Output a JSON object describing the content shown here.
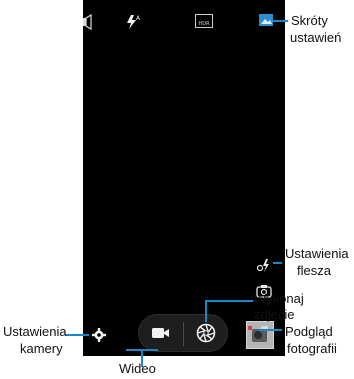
{
  "top_bar": {
    "icons": [
      "volume-key-icon",
      "flash-auto-icon",
      "hdr-icon",
      "shortcuts-icon"
    ],
    "hdr_text": "HDR"
  },
  "side_controls": {
    "icons": [
      "flash-settings-icon",
      "camera-switch-icon"
    ]
  },
  "bottom_bar": {
    "icons": [
      "gear-icon",
      "video-camera-icon",
      "shutter-icon",
      "thumbnail-preview"
    ]
  },
  "callouts": {
    "shortcuts": [
      "Skróty",
      "ustawień"
    ],
    "flash": [
      "Ustawienia",
      "flesza"
    ],
    "take_photo": [
      "Wykonaj",
      "zdjęcie"
    ],
    "preview": [
      "Podgląd",
      "fotografii"
    ],
    "camera_settings": [
      "Ustawienia",
      "kamery"
    ],
    "video": "Wideo"
  },
  "colors": {
    "viewfinder": "#000000",
    "accent": "#1b87c9",
    "active_icon": "#2a8fd0"
  }
}
